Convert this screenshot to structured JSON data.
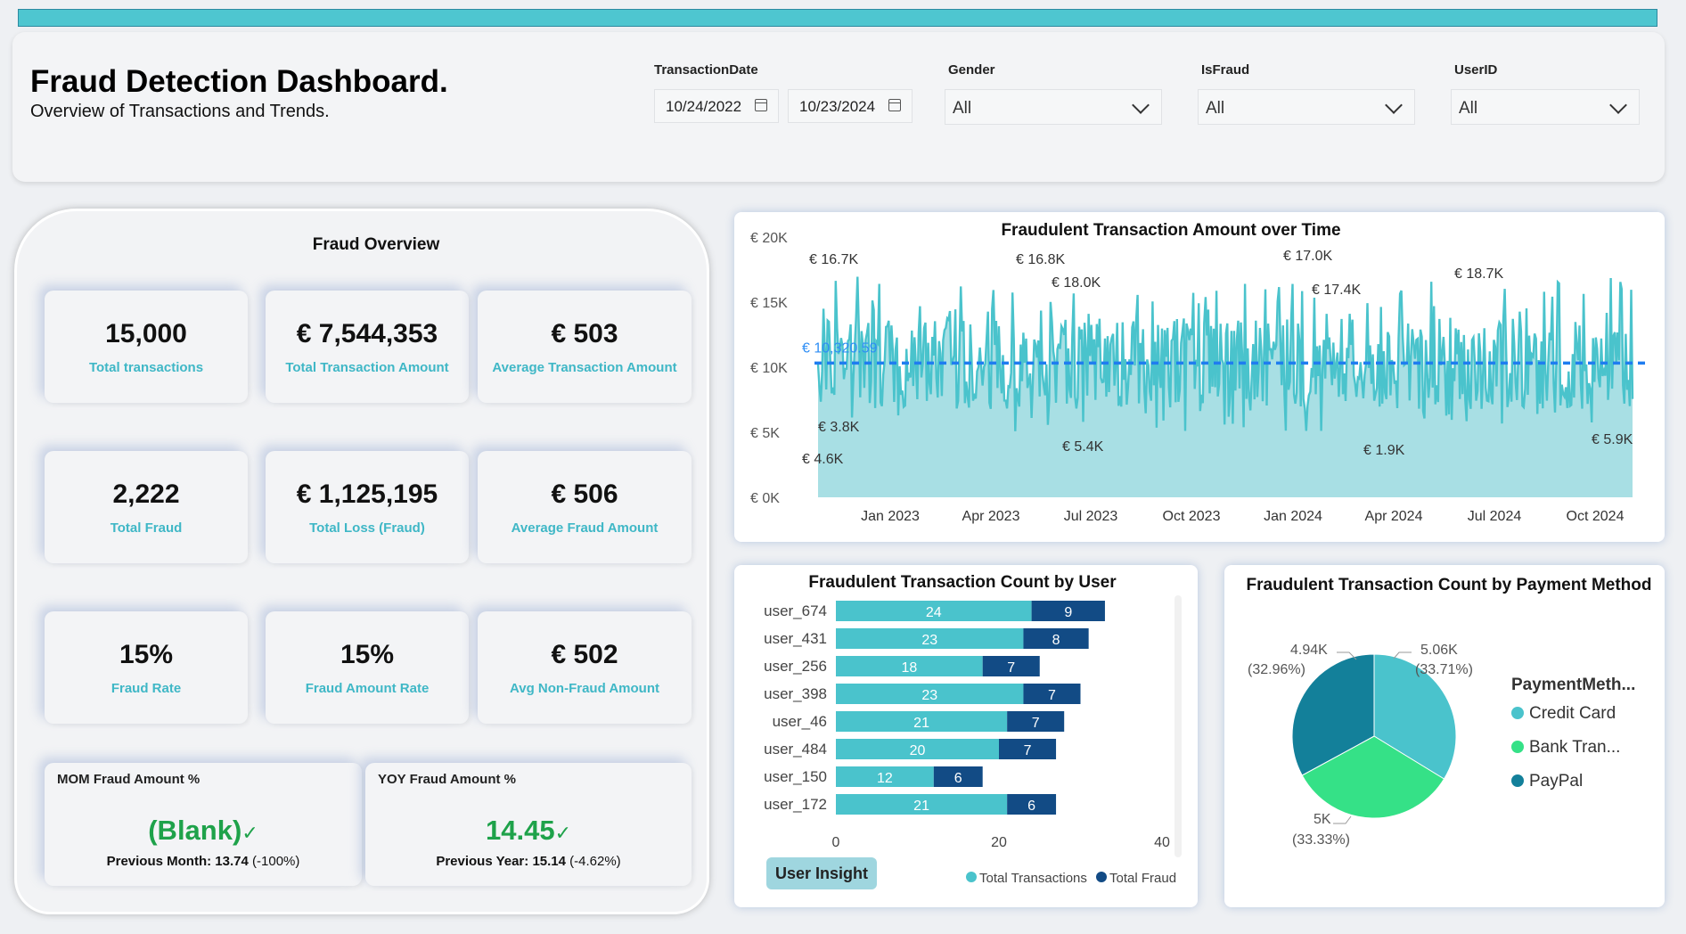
{
  "header": {
    "title": "Fraud Detection Dashboard.",
    "subtitle": "Overview of Transactions and Trends."
  },
  "filters": {
    "transaction_date": {
      "label": "TransactionDate",
      "start": "10/24/2022",
      "end": "10/23/2024"
    },
    "gender": {
      "label": "Gender",
      "value": "All"
    },
    "is_fraud": {
      "label": "IsFraud",
      "value": "All"
    },
    "user_id": {
      "label": "UserID",
      "value": "All"
    }
  },
  "overview": {
    "title": "Fraud Overview",
    "kpis": [
      {
        "value": "15,000",
        "label": "Total transactions"
      },
      {
        "value": "€ 7,544,353",
        "label": "Total Transaction Amount"
      },
      {
        "value": "€ 503",
        "label": "Average Transaction Amount"
      },
      {
        "value": "2,222",
        "label": "Total Fraud"
      },
      {
        "value": "€ 1,125,195",
        "label": "Total Loss (Fraud)"
      },
      {
        "value": "€ 506",
        "label": "Average Fraud Amount"
      },
      {
        "value": "15%",
        "label": "Fraud Rate"
      },
      {
        "value": "15%",
        "label": "Fraud Amount Rate"
      },
      {
        "value": "€ 502",
        "label": "Avg Non-Fraud Amount"
      }
    ],
    "mom": {
      "title": "MOM Fraud Amount %",
      "value": "(Blank)",
      "check": "✓",
      "prev_label": "Previous Month:",
      "prev_value": "13.74",
      "prev_change": "(-100%)"
    },
    "yoy": {
      "title": "YOY Fraud Amount %",
      "value": "14.45",
      "check": "✓",
      "prev_label": "Previous Year:",
      "prev_value": "15.14",
      "prev_change": "(-4.62%)"
    }
  },
  "time_chart": {
    "title": "Fraudulent Transaction Amount over Time",
    "average_label": "€ 10,320.59",
    "y_ticks": [
      "€ 20K",
      "€ 15K",
      "€ 10K",
      "€ 5K",
      "€ 0K"
    ],
    "x_ticks": [
      "Jan 2023",
      "Apr 2023",
      "Jul 2023",
      "Oct 2023",
      "Jan 2024",
      "Apr 2024",
      "Jul 2024",
      "Oct 2024"
    ],
    "annotations": [
      "€ 16.7K",
      "€ 16.8K",
      "€ 18.0K",
      "€ 17.0K",
      "€ 17.4K",
      "€ 18.7K",
      "€ 3.8K",
      "€ 4.6K",
      "€ 5.4K",
      "€ 1.9K",
      "€ 5.9K"
    ]
  },
  "user_chart": {
    "title": "Fraudulent Transaction Count by User",
    "x_ticks": [
      "0",
      "20",
      "40"
    ],
    "legend": [
      "Total Transactions",
      "Total Fraud"
    ],
    "button": "User Insight"
  },
  "pie_chart": {
    "title": "Fraudulent Transaction Count by Payment Method",
    "legend_title": "PaymentMeth...",
    "legend": [
      "Credit Card",
      "Bank Tran...",
      "PayPal"
    ],
    "labels": [
      {
        "value": "5.06K",
        "pct": "(33.71%)"
      },
      {
        "value": "5K",
        "pct": "(33.33%)"
      },
      {
        "value": "4.94K",
        "pct": "(32.96%)"
      }
    ]
  },
  "colors": {
    "teal": "#4ac3cc",
    "navy": "#124b85",
    "green": "#35e187",
    "dark_teal": "#13809a",
    "area": "#a8dfe4",
    "avg_line": "#1f7df0",
    "positive": "#1ea24a"
  },
  "chart_data": [
    {
      "type": "line",
      "title": "Fraudulent Transaction Amount over Time",
      "x_range": [
        "2022-10-24",
        "2024-10-23"
      ],
      "ylim": [
        0,
        20000
      ],
      "y_tick_values": [
        0,
        5000,
        10000,
        15000,
        20000
      ],
      "average": 10320.59,
      "highlight_points": [
        {
          "x": "2022-12",
          "y": 16700
        },
        {
          "x": "2022-10",
          "y": 3800
        },
        {
          "x": "2022-10",
          "y": 4600
        },
        {
          "x": "2023-05",
          "y": 16800
        },
        {
          "x": "2023-06",
          "y": 18000
        },
        {
          "x": "2023-06",
          "y": 5400
        },
        {
          "x": "2023-12",
          "y": 17000
        },
        {
          "x": "2024-01",
          "y": 17400
        },
        {
          "x": "2024-03",
          "y": 1900
        },
        {
          "x": "2024-07",
          "y": 18700
        },
        {
          "x": "2024-10",
          "y": 5900
        }
      ]
    },
    {
      "type": "bar",
      "orientation": "horizontal",
      "stacked": true,
      "title": "Fraudulent Transaction Count by User",
      "categories": [
        "user_674",
        "user_431",
        "user_256",
        "user_398",
        "user_46",
        "user_484",
        "user_150",
        "user_172"
      ],
      "series": [
        {
          "name": "Total Transactions",
          "values": [
            24,
            23,
            18,
            23,
            21,
            20,
            12,
            21
          ]
        },
        {
          "name": "Total Fraud",
          "values": [
            9,
            8,
            7,
            7,
            7,
            7,
            6,
            6
          ]
        }
      ],
      "xlim": [
        0,
        40
      ]
    },
    {
      "type": "pie",
      "title": "Fraudulent Transaction Count by Payment Method",
      "categories": [
        "Credit Card",
        "Bank Tran...",
        "PayPal"
      ],
      "values": [
        5060,
        5000,
        4940
      ],
      "percents": [
        33.71,
        33.33,
        32.96
      ]
    }
  ]
}
